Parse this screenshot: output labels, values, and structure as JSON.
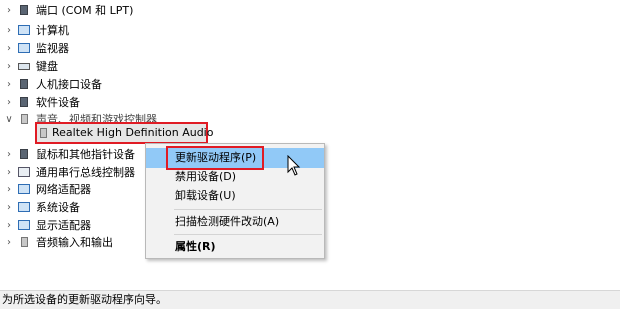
{
  "tree": {
    "items": [
      {
        "label": "端口 (COM 和 LPT)",
        "chevron": ">",
        "icon": "port-icon"
      },
      {
        "label": "计算机",
        "chevron": ">",
        "icon": "computer-icon"
      },
      {
        "label": "监视器",
        "chevron": ">",
        "icon": "monitor-icon"
      },
      {
        "label": "键盘",
        "chevron": ">",
        "icon": "keyboard-icon"
      },
      {
        "label": "人机接口设备",
        "chevron": ">",
        "icon": "hid-icon"
      },
      {
        "label": "软件设备",
        "chevron": ">",
        "icon": "software-device-icon"
      },
      {
        "label": "声音、视频和游戏控制器",
        "chevron": "v",
        "icon": "speaker-icon"
      },
      {
        "label": "鼠标和其他指针设备",
        "chevron": ">",
        "icon": "mouse-icon"
      },
      {
        "label": "通用串行总线控制器",
        "chevron": ">",
        "icon": "usb-icon"
      },
      {
        "label": "网络适配器",
        "chevron": ">",
        "icon": "network-adapter-icon"
      },
      {
        "label": "系统设备",
        "chevron": ">",
        "icon": "system-device-icon"
      },
      {
        "label": "显示适配器",
        "chevron": ">",
        "icon": "display-adapter-icon"
      },
      {
        "label": "音频输入和输出",
        "chevron": ">",
        "icon": "audio-io-icon"
      }
    ],
    "selected_child": "Realtek High Definition Audio"
  },
  "context_menu": {
    "items": [
      {
        "label": "更新驱动程序(P)",
        "highlighted": true
      },
      {
        "label": "禁用设备(D)"
      },
      {
        "label": "卸载设备(U)"
      },
      {
        "label": "扫描检测硬件改动(A)"
      },
      {
        "label": "属性(R)",
        "bold": true
      }
    ]
  },
  "status_bar": {
    "text": "为所选设备的更新驱动程序向导。"
  },
  "colors": {
    "highlight": "#91c9f7",
    "annotation_red": "#e01b24",
    "selection": "#e6e6e6"
  }
}
